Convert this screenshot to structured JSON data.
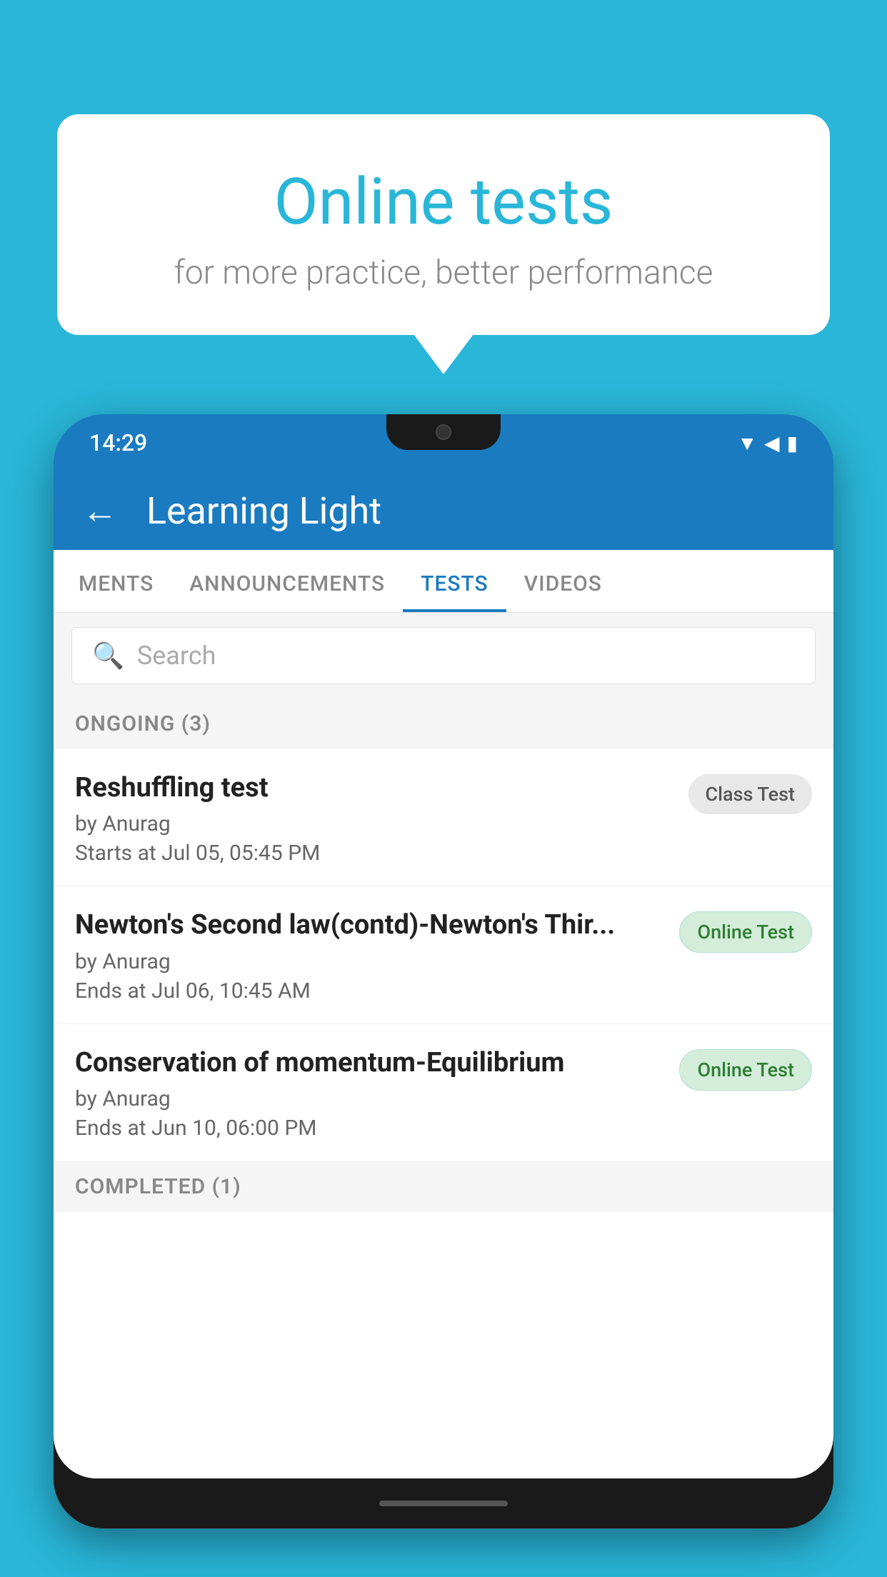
{
  "background_color": "#29b6d8",
  "bubble": {
    "title": "Online tests",
    "subtitle": "for more practice, better performance"
  },
  "phone": {
    "status_bar": {
      "time": "14:29",
      "icons": [
        "▼",
        "◀",
        "▮"
      ]
    },
    "app_bar": {
      "back_label": "←",
      "title": "Learning Light"
    },
    "tabs": [
      {
        "label": "MENTS",
        "active": false
      },
      {
        "label": "ANNOUNCEMENTS",
        "active": false
      },
      {
        "label": "TESTS",
        "active": true
      },
      {
        "label": "VIDEOS",
        "active": false
      }
    ],
    "search": {
      "placeholder": "Search",
      "icon": "🔍"
    },
    "ongoing_section": {
      "label": "ONGOING (3)",
      "tests": [
        {
          "title": "Reshuffling test",
          "author": "by Anurag",
          "date": "Starts at  Jul 05, 05:45 PM",
          "badge": "Class Test",
          "badge_type": "class"
        },
        {
          "title": "Newton's Second law(contd)-Newton's Thir...",
          "author": "by Anurag",
          "date": "Ends at  Jul 06, 10:45 AM",
          "badge": "Online Test",
          "badge_type": "online"
        },
        {
          "title": "Conservation of momentum-Equilibrium",
          "author": "by Anurag",
          "date": "Ends at  Jun 10, 06:00 PM",
          "badge": "Online Test",
          "badge_type": "online"
        }
      ]
    },
    "completed_section": {
      "label": "COMPLETED (1)"
    }
  }
}
